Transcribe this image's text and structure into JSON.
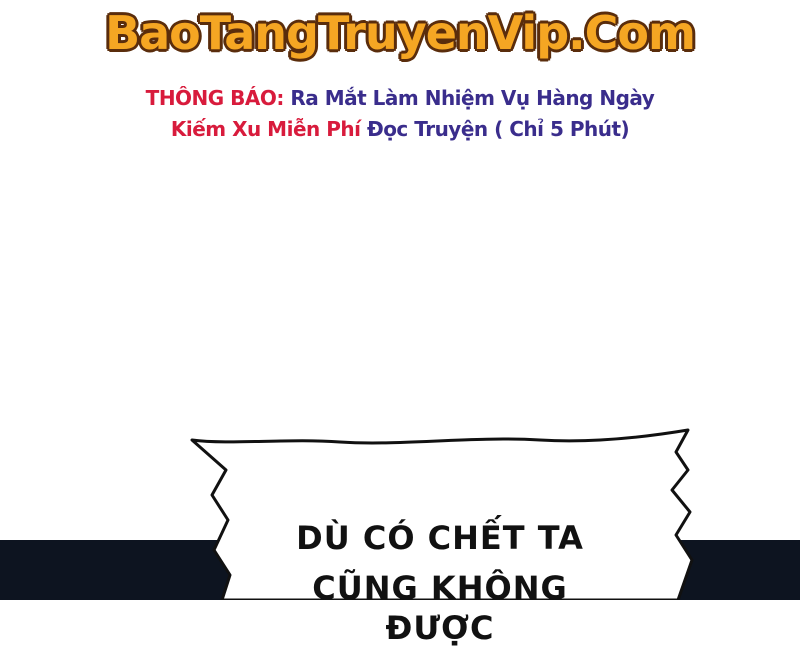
{
  "header": {
    "site_name": "BaoTangTruyenVip.Com"
  },
  "notice": {
    "label": "THÔNG BÁO:",
    "line1_text": "Ra Mắt Làm Nhiệm Vụ Hàng Ngày",
    "line2_red": "Kiếm Xu Miễn Phí",
    "line2_blue": "Đọc Truyện ( Chỉ 5 Phút)"
  },
  "speech_bubble": {
    "line1": "DÙ CÓ CHẾT TA",
    "line2": "CŨNG KHÔNG ĐƯỢC"
  },
  "colors": {
    "logo": "#f5a623",
    "logo_outline": "#5a2d0c",
    "notice_red": "#d81b3c",
    "notice_blue": "#3a2d8c",
    "panel_dark": "#0d1420"
  }
}
